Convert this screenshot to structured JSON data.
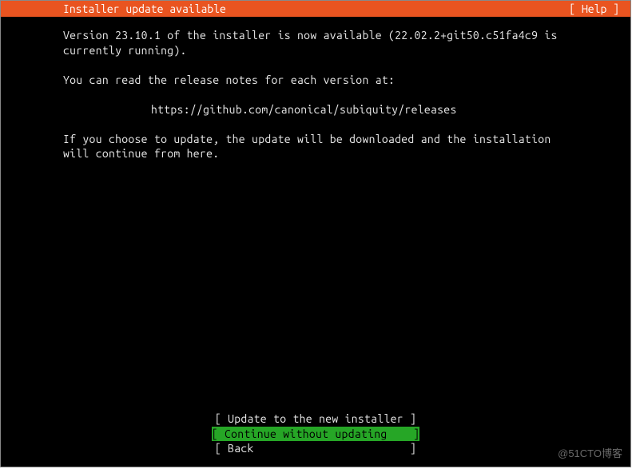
{
  "header": {
    "title": "Installer update available",
    "help_label": "[ Help ]"
  },
  "body": {
    "line1": "Version 23.10.1 of the installer is now available (22.02.2+git50.c51fa4c9 is currently running).",
    "line2": "You can read the release notes for each version at:",
    "url": "https://github.com/canonical/subiquity/releases",
    "line3": "If you choose to update, the update will be downloaded and the installation will continue from here."
  },
  "buttons": {
    "update": "[ Update to the new installer ]",
    "continue": "[ Continue without updating    ]",
    "back": "[ Back                        ]"
  },
  "watermark": "@51CTO博客"
}
